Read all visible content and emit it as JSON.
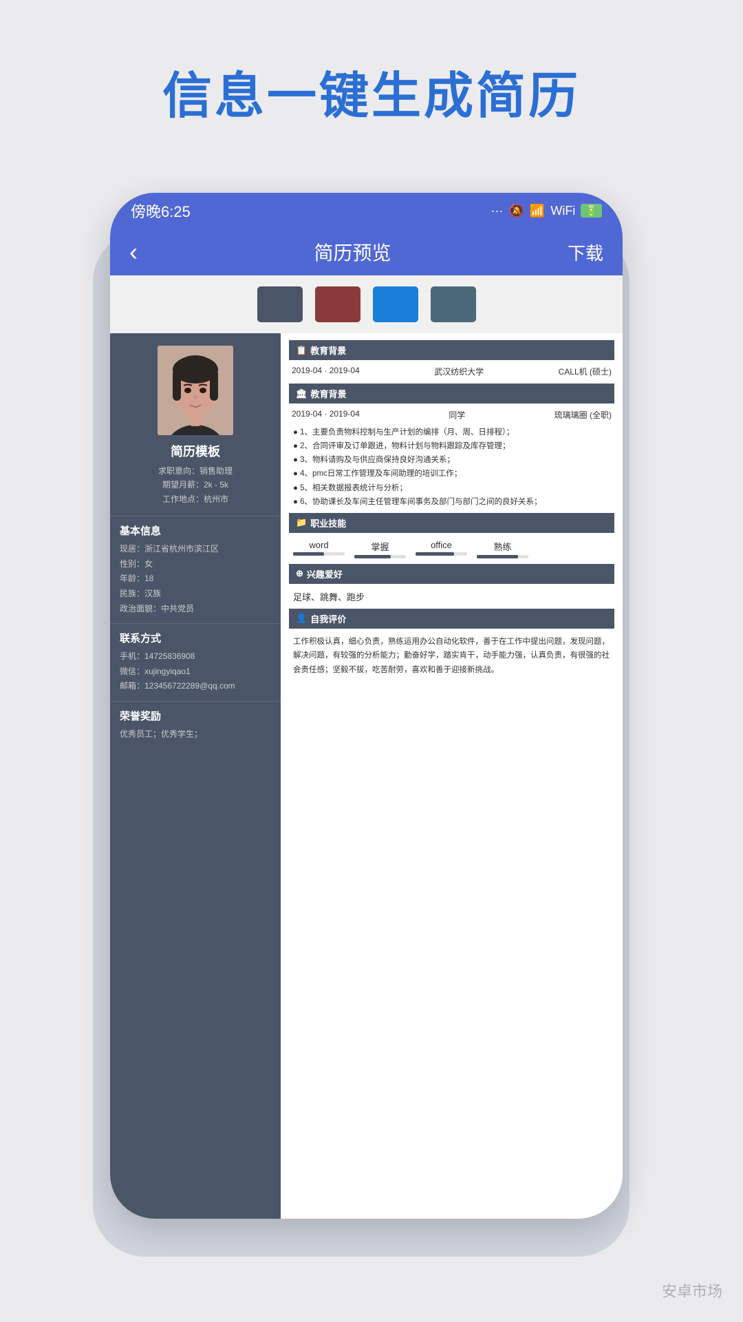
{
  "page": {
    "title": "信息一键生成简历",
    "background": "#f0f2f5"
  },
  "status_bar": {
    "time": "傍晚6:25",
    "icons": "... ᯤ ᵴ ⊛ 🔋"
  },
  "nav": {
    "back_icon": "‹",
    "title": "简历预览",
    "download": "下载"
  },
  "color_swatches": [
    {
      "color": "#4a5568",
      "id": "dark-gray"
    },
    {
      "color": "#8b3a3a",
      "id": "dark-red"
    },
    {
      "color": "#1a7fdb",
      "id": "blue"
    },
    {
      "color": "#4a6878",
      "id": "teal-gray"
    }
  ],
  "resume": {
    "left": {
      "name": "简历模板",
      "job_seek": "求职意向：销售助理",
      "salary": "期望月薪：2k - 5k",
      "location": "工作地点：杭州市",
      "basic_info_title": "基本信息",
      "address": "现居：浙江省杭州市滨江区",
      "gender": "性别：女",
      "age": "年龄：18",
      "ethnicity": "民族：汉族",
      "politics": "政治面貌：中共党员",
      "contact_title": "联系方式",
      "phone": "手机：14725836908",
      "wechat": "微信：xujingyiqao1",
      "email": "邮箱：123456722289@qq.com",
      "awards_title": "荣誉奖励",
      "awards_content": "优秀员工；优秀学生；"
    },
    "right": {
      "edu1_title": "教育背景",
      "edu1_date": "2019-04 · 2019-04",
      "edu1_school": "武汉纺织大学",
      "edu1_degree": "CALL机 (硕士)",
      "edu2_title": "教育背景",
      "edu2_date": "2019-04 · 2019-04",
      "edu2_company": "同学",
      "edu2_type": "琉璃璃圈 (全职)",
      "bullets": [
        "1、主要负责物料控制与生产计划的编排（月、周、日排程）；",
        "2、合同评审及订单跟进，物料计划与物料跟踪及库存管理；",
        "3、物料请购及与供应商保持良好沟通关系；",
        "4、pmc日常工作管理及车间助理的培训工作；",
        "5、相关数据报表统计与分析；",
        "6、协助课长及车间主任管理车间事务及部门与部门之间的良好关系；"
      ],
      "skills_title": "职业技能",
      "skills": [
        {
          "name": "word",
          "level": 60
        },
        {
          "name": "掌握",
          "level": 70
        },
        {
          "name": "office",
          "level": 75
        },
        {
          "name": "熟练",
          "level": 80
        }
      ],
      "interests_title": "兴趣爱好",
      "interests": "足球、跳舞、跑步",
      "self_eval_title": "自我评价",
      "self_eval": "工作积极认真，细心负责，熟练运用办公自动化软件，善于在工作中提出问题，发现问题，解决问题，有较强的分析能力；勤奋好学，踏实肯干，动手能力强，认真负责，有很强的社会责任感；坚毅不拔，吃苦耐劳，喜欢和善于迎接新挑战。"
    }
  },
  "watermark": "安卓市场"
}
